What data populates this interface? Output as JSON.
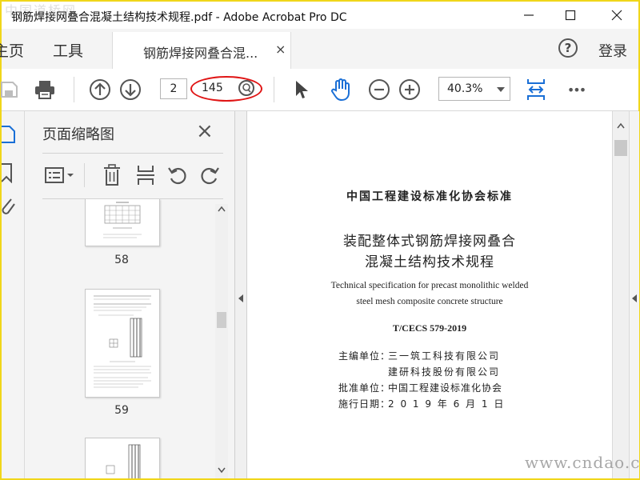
{
  "window": {
    "title": "钢筋焊接网叠合混凝土结构技术规程.pdf - Adobe Acrobat Pro DC",
    "watermark": "中国道桥网",
    "controls": [
      "minimize-icon",
      "maximize-icon",
      "close-icon"
    ]
  },
  "tabs": {
    "home_label": "主页",
    "tools_label": "工具",
    "document_tab_label": "钢筋焊接网叠合混...",
    "close_symbol": "×",
    "help_symbol": "?",
    "sign_in_label": "登录"
  },
  "toolbar": {
    "current_page": "2",
    "total_pages": "145",
    "zoom": "40.3%",
    "more_symbol": "•••",
    "icons": [
      "save-icon",
      "print-icon",
      "page-up-icon",
      "page-down-icon",
      "search-icon",
      "select-cursor-icon",
      "hand-tool-icon",
      "zoom-out-icon",
      "zoom-in-icon",
      "fit-page-icon",
      "more-icon"
    ]
  },
  "thumbnails_panel": {
    "title": "页面缩略图",
    "close_symbol": "×",
    "pages": [
      {
        "number": "58"
      },
      {
        "number": "59"
      }
    ]
  },
  "document": {
    "org_standard": "中国工程建设标准化协会标准",
    "title_cn_line1": "装配整体式钢筋焊接网叠合",
    "title_cn_line2": "混凝土结构技术规程",
    "title_en_line1": "Technical specification for precast monolithic welded",
    "title_en_line2": "steel mesh composite concrete structure",
    "code": "T/CECS 579-2019",
    "chief_editor_label": "主编单位：",
    "chief_editor_1": "三一筑工科技有限公司",
    "chief_editor_2": "建研科技股份有限公司",
    "approval_label": "批准单位：",
    "approval_value": "中国工程建设标准化协会",
    "effective_label": "施行日期：",
    "effective_value": "2 0 1 9 年 6 月 1 日"
  },
  "site_watermark": "www.cndao.com",
  "colors": {
    "accent_blue": "#1a6fd6",
    "highlight_red": "#e01515",
    "frame_yellow": "#f0d61a"
  }
}
